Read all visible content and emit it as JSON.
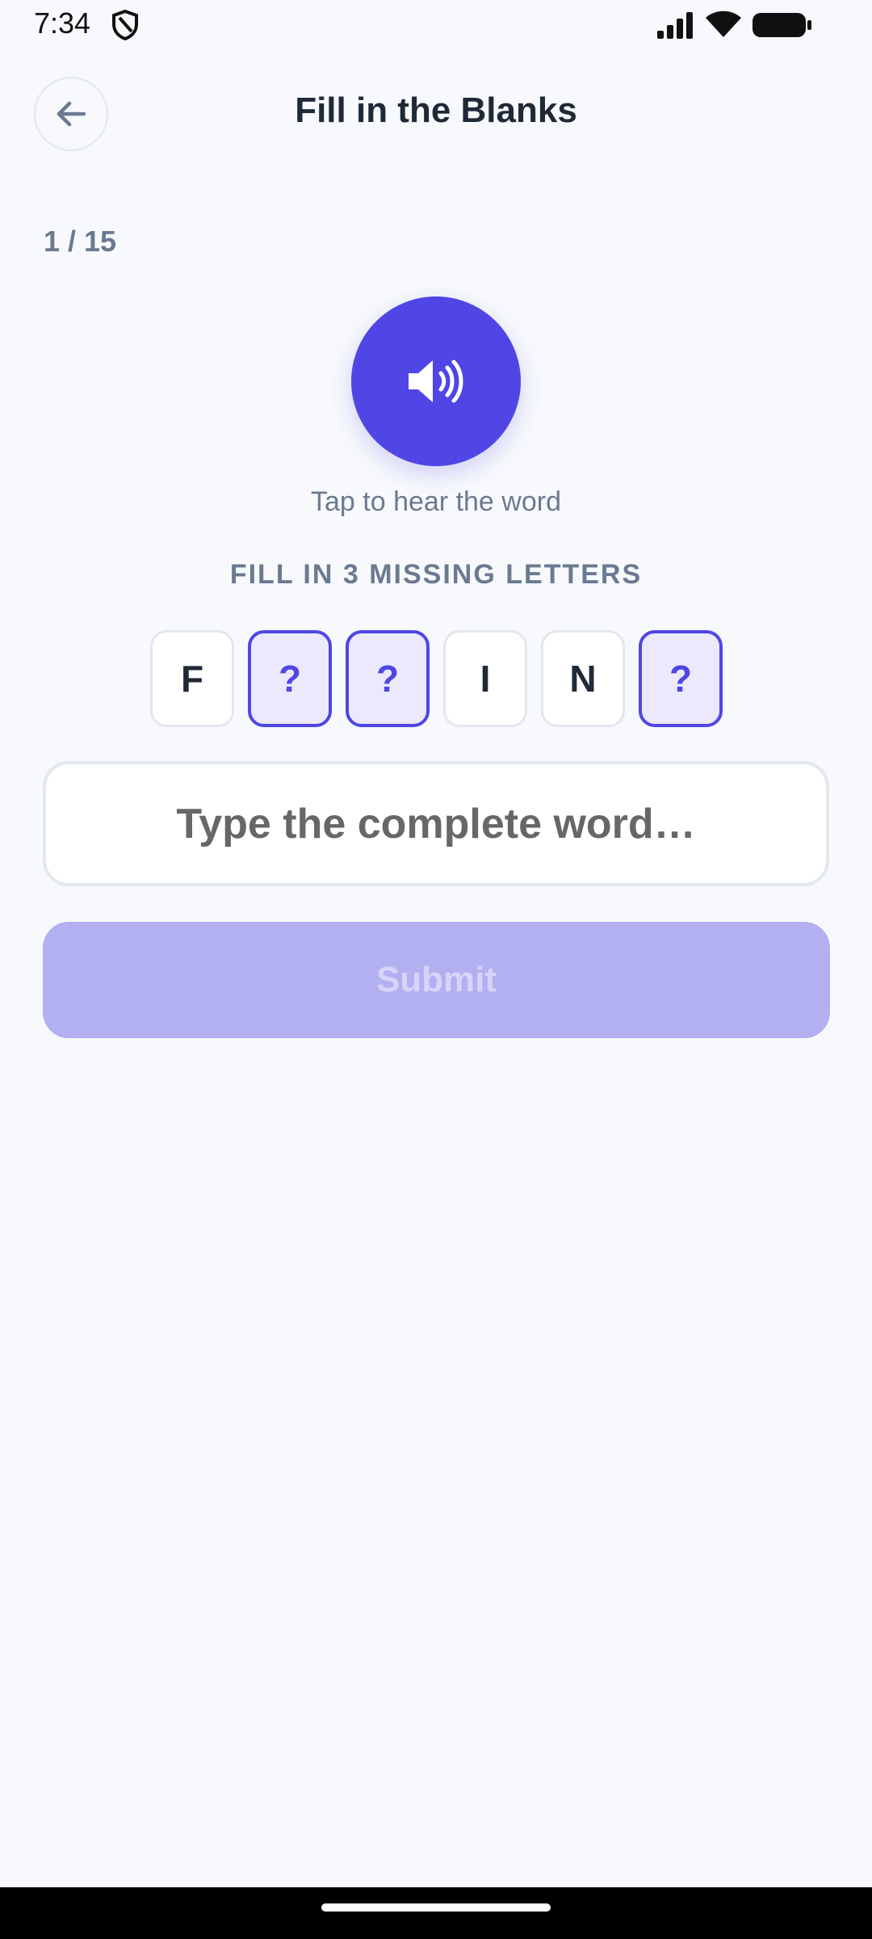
{
  "status_bar": {
    "time": "7:34",
    "icons": [
      "shield-icon",
      "signal-icon",
      "wifi-icon",
      "battery-icon"
    ]
  },
  "header": {
    "title": "Fill in the Blanks",
    "back_icon": "arrow-left-icon"
  },
  "progress": {
    "text": "1 / 15",
    "current": 1,
    "total": 15
  },
  "audio": {
    "icon": "speaker-icon",
    "hint": "Tap to hear the word"
  },
  "instruction": "FILL IN 3 MISSING LETTERS",
  "tiles": [
    {
      "char": "F",
      "missing": false
    },
    {
      "char": "?",
      "missing": true
    },
    {
      "char": "?",
      "missing": true
    },
    {
      "char": "I",
      "missing": false
    },
    {
      "char": "N",
      "missing": false
    },
    {
      "char": "?",
      "missing": true
    }
  ],
  "input": {
    "value": "",
    "placeholder": "Type the complete word…"
  },
  "submit": {
    "label": "Submit",
    "enabled": false
  },
  "colors": {
    "accent": "#4f46e5",
    "background": "#f7f9fc",
    "muted_text": "#6b7a90",
    "submit_disabled_bg": "#b3b0f2"
  }
}
